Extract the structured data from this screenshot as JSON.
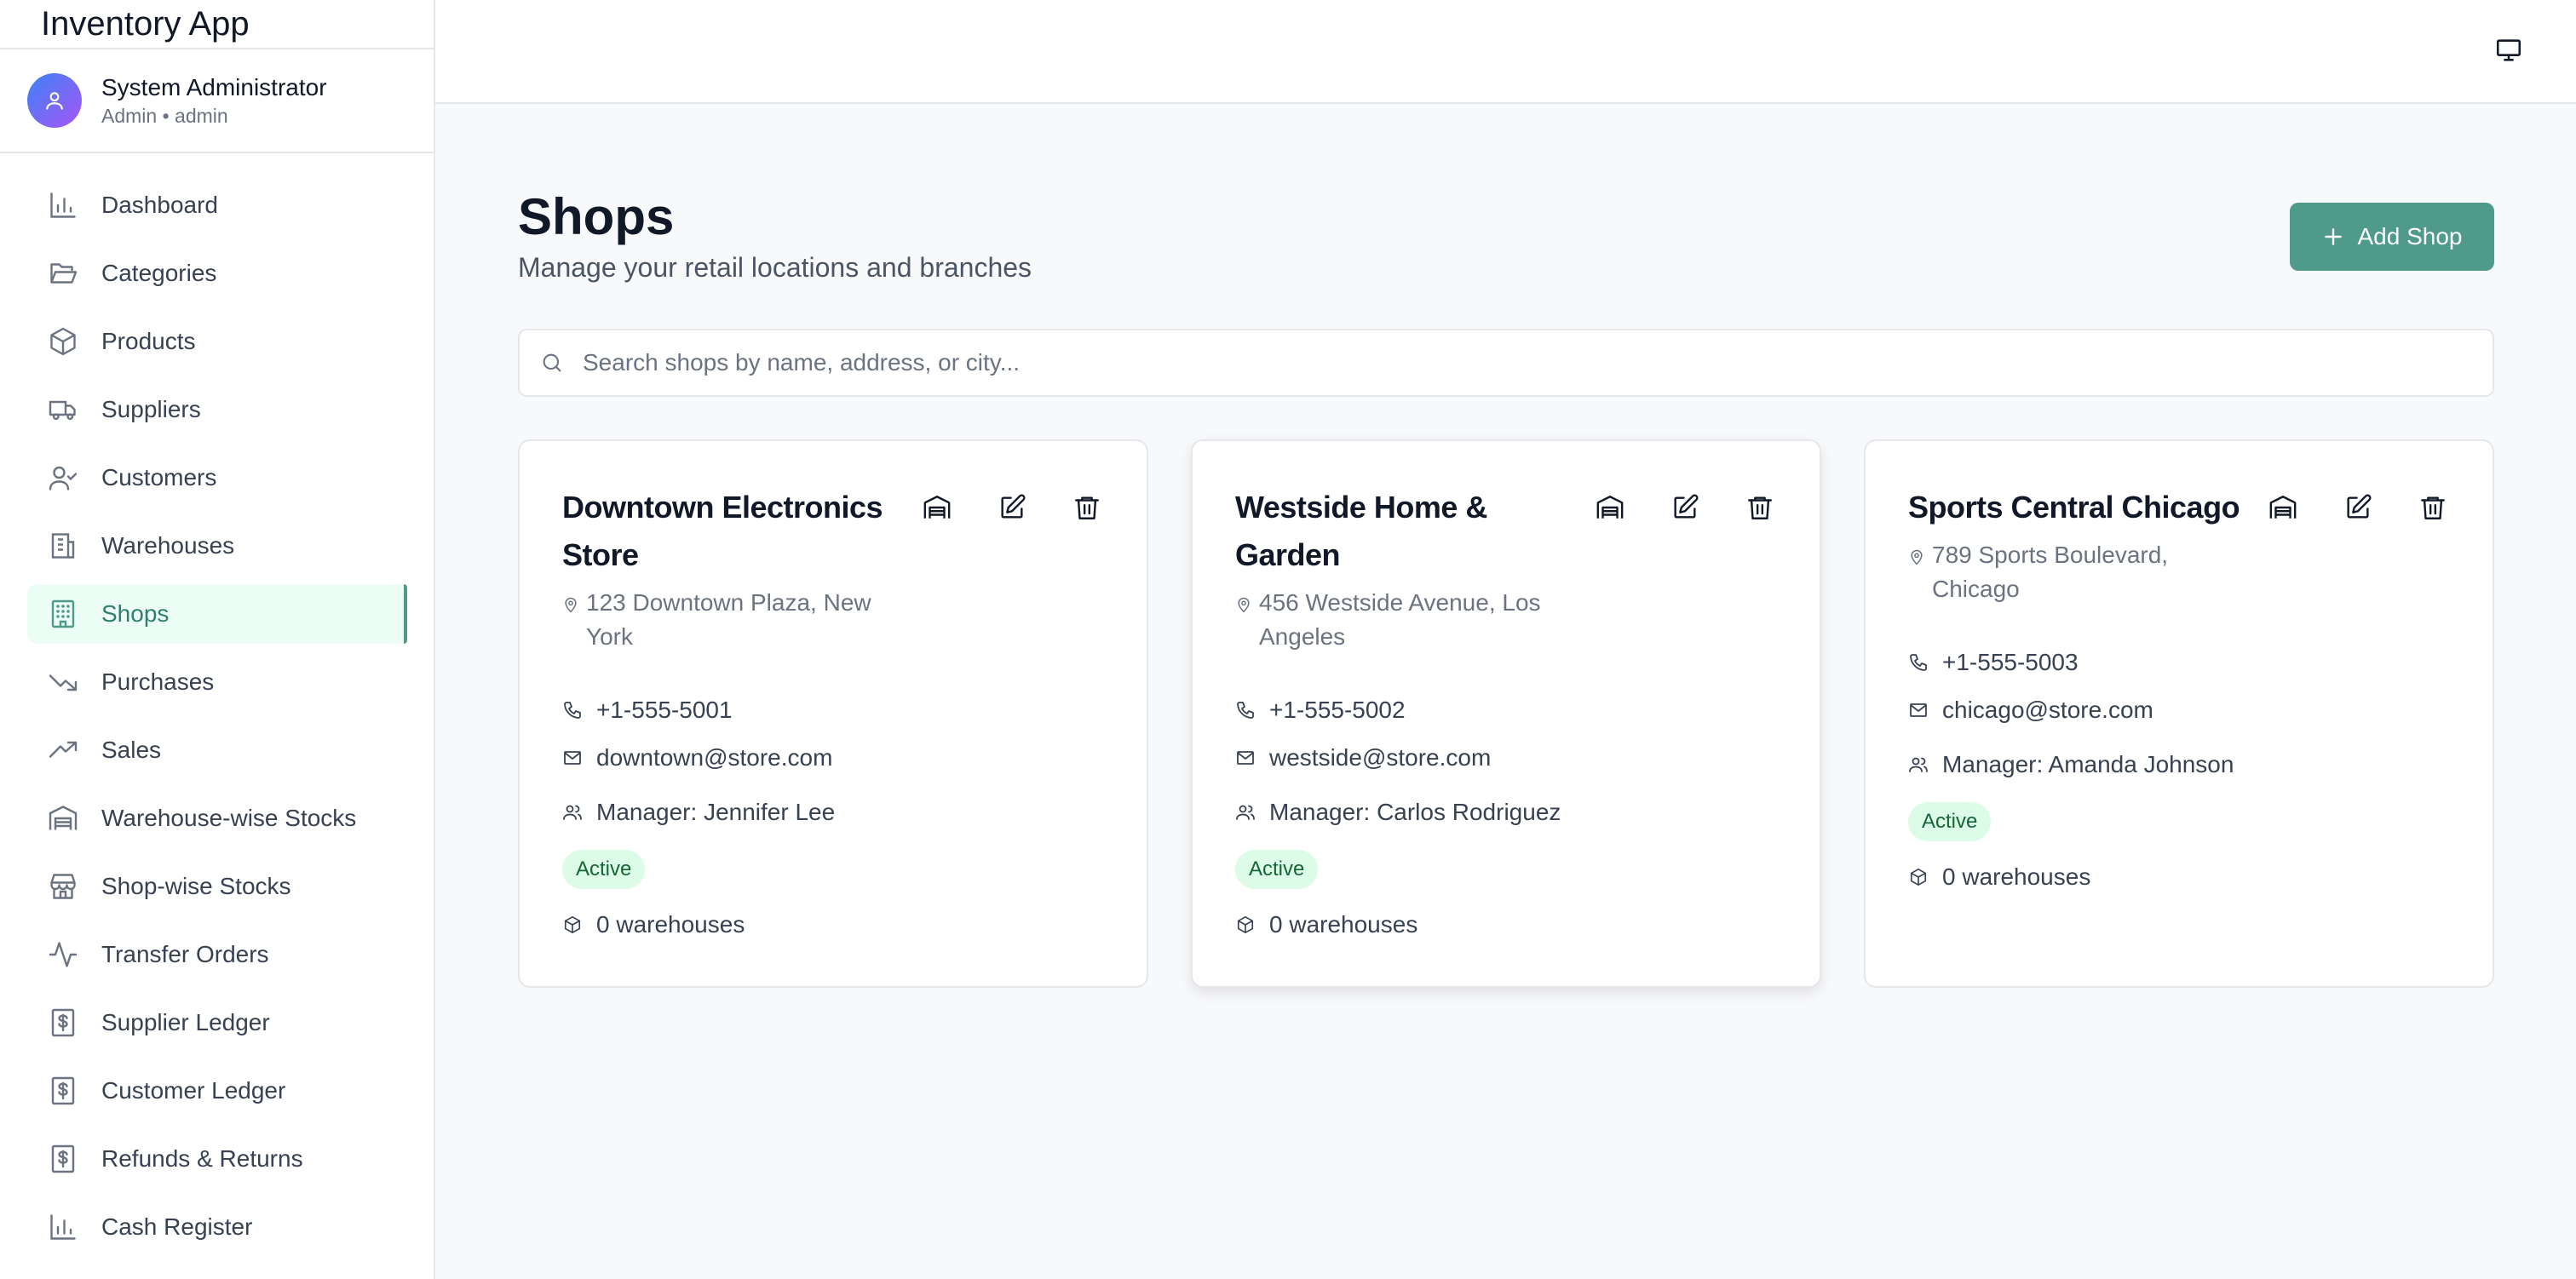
{
  "app": {
    "title": "Inventory App"
  },
  "user": {
    "name": "System Administrator",
    "role": "Admin • admin"
  },
  "sidebar": {
    "items": [
      {
        "label": "Dashboard",
        "icon": "bar-chart-icon",
        "active": false
      },
      {
        "label": "Categories",
        "icon": "folder-open-icon",
        "active": false
      },
      {
        "label": "Products",
        "icon": "package-icon",
        "active": false
      },
      {
        "label": "Suppliers",
        "icon": "truck-icon",
        "active": false
      },
      {
        "label": "Customers",
        "icon": "user-check-icon",
        "active": false
      },
      {
        "label": "Warehouses",
        "icon": "building-icon",
        "active": false
      },
      {
        "label": "Shops",
        "icon": "building-grid-icon",
        "active": true
      },
      {
        "label": "Purchases",
        "icon": "trending-down-icon",
        "active": false
      },
      {
        "label": "Sales",
        "icon": "trending-up-icon",
        "active": false
      },
      {
        "label": "Warehouse-wise Stocks",
        "icon": "warehouse-icon",
        "active": false
      },
      {
        "label": "Shop-wise Stocks",
        "icon": "store-icon",
        "active": false
      },
      {
        "label": "Transfer Orders",
        "icon": "activity-icon",
        "active": false
      },
      {
        "label": "Supplier Ledger",
        "icon": "dollar-receipt-icon",
        "active": false
      },
      {
        "label": "Customer Ledger",
        "icon": "dollar-receipt-icon",
        "active": false
      },
      {
        "label": "Refunds & Returns",
        "icon": "dollar-receipt-icon",
        "active": false
      },
      {
        "label": "Cash Register",
        "icon": "bar-chart-icon",
        "active": false
      }
    ]
  },
  "topbar": {
    "icon": "monitor-icon"
  },
  "page": {
    "title": "Shops",
    "subtitle": "Manage your retail locations and branches",
    "add_button": "Add Shop"
  },
  "search": {
    "placeholder": "Search shops by name, address, or city..."
  },
  "shops": [
    {
      "name": "Downtown Electronics Store",
      "address": "123 Downtown Plaza, New York",
      "phone": "+1-555-5001",
      "email": "downtown@store.com",
      "manager": "Manager: Jennifer Lee",
      "status": "Active",
      "warehouses": "0 warehouses"
    },
    {
      "name": "Westside Home & Garden",
      "address": "456 Westside Avenue, Los Angeles",
      "phone": "+1-555-5002",
      "email": "westside@store.com",
      "manager": "Manager: Carlos Rodriguez",
      "status": "Active",
      "warehouses": "0 warehouses"
    },
    {
      "name": "Sports Central Chicago",
      "address": "789 Sports Boulevard, Chicago",
      "phone": "+1-555-5003",
      "email": "chicago@store.com",
      "manager": "Manager: Amanda Johnson",
      "status": "Active",
      "warehouses": "0 warehouses"
    }
  ],
  "colors": {
    "accent": "#4f9a8b",
    "active_bg": "#ecfdf5",
    "badge_bg": "#dcfce7",
    "badge_text": "#166534"
  }
}
